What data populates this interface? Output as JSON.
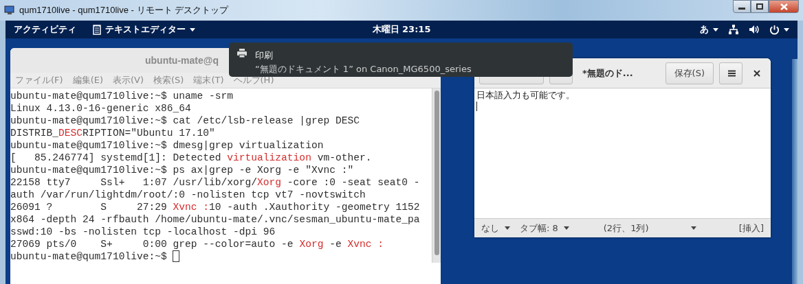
{
  "rdp_window": {
    "title": "qum1710live - qum1710live - リモート デスクトップ"
  },
  "top_bar": {
    "activities": "アクティビティ",
    "app_menu": "テキストエディター",
    "clock": "木曜日 23:15",
    "input_method": "あ"
  },
  "terminal": {
    "title": "ubuntu-mate@q",
    "menu": [
      "ファイル(F)",
      "編集(E)",
      "表示(V)",
      "検索(S)",
      "端末(T)",
      "ヘルプ(H)"
    ],
    "lines": [
      [
        {
          "text": "ubuntu-mate@qum1710live:~$ uname -srm",
          "red": false
        }
      ],
      [
        {
          "text": "Linux 4.13.0-16-generic x86_64",
          "red": false
        }
      ],
      [
        {
          "text": "ubuntu-mate@qum1710live:~$ cat /etc/lsb-release |grep DESC",
          "red": false
        }
      ],
      [
        {
          "text": "DISTRIB_",
          "red": false
        },
        {
          "text": "DESC",
          "red": true
        },
        {
          "text": "RIPTION=\"Ubuntu 17.10\"",
          "red": false
        }
      ],
      [
        {
          "text": "ubuntu-mate@qum1710live:~$ dmesg|grep virtualization",
          "red": false
        }
      ],
      [
        {
          "text": "[   85.246774] systemd[1]: Detected ",
          "red": false
        },
        {
          "text": "virtualization",
          "red": true
        },
        {
          "text": " vm-other.",
          "red": false
        }
      ],
      [
        {
          "text": "ubuntu-mate@qum1710live:~$ ps ax|grep -e Xorg -e \"Xvnc :\"",
          "red": false
        }
      ],
      [
        {
          "text": "22158 tty7     Ssl+   1:07 /usr/lib/xorg/",
          "red": false
        },
        {
          "text": "Xorg",
          "red": true
        },
        {
          "text": " -core :0 -seat seat0 -",
          "red": false
        }
      ],
      [
        {
          "text": "auth /var/run/lightdm/root/:0 -nolisten tcp vt7 -novtswitch",
          "red": false
        }
      ],
      [
        {
          "text": "26091 ?        S     27:29 ",
          "red": false
        },
        {
          "text": "Xvnc :",
          "red": true
        },
        {
          "text": "10 -auth .Xauthority -geometry 1152",
          "red": false
        }
      ],
      [
        {
          "text": "x864 -depth 24 -rfbauth /home/ubuntu-mate/.vnc/sesman_ubuntu-mate_pa",
          "red": false
        }
      ],
      [
        {
          "text": "sswd:10 -bs -nolisten tcp -localhost -dpi 96",
          "red": false
        }
      ],
      [
        {
          "text": "27069 pts/0    S+     0:00 grep --color=auto -e ",
          "red": false
        },
        {
          "text": "Xorg",
          "red": true
        },
        {
          "text": " -e ",
          "red": false
        },
        {
          "text": "Xvnc :",
          "red": true
        }
      ],
      [
        {
          "text": "ubuntu-mate@qum1710live:~$ ",
          "red": false
        }
      ]
    ]
  },
  "editor": {
    "title": "*無題のド...",
    "save_button": "保存(S)",
    "text": "日本語入力も可能です。",
    "status": [
      {
        "kind": "dropdown",
        "label": "なし"
      },
      {
        "kind": "dropdown",
        "label": "タブ幅: 8"
      },
      {
        "kind": "text",
        "label": "(2行、1列)"
      },
      {
        "kind": "caret"
      },
      {
        "kind": "text",
        "label": "[挿入]"
      }
    ]
  },
  "notification": {
    "title": "印刷",
    "body": "“無題のドキュメント 1” on Canon_MG6500_series"
  }
}
